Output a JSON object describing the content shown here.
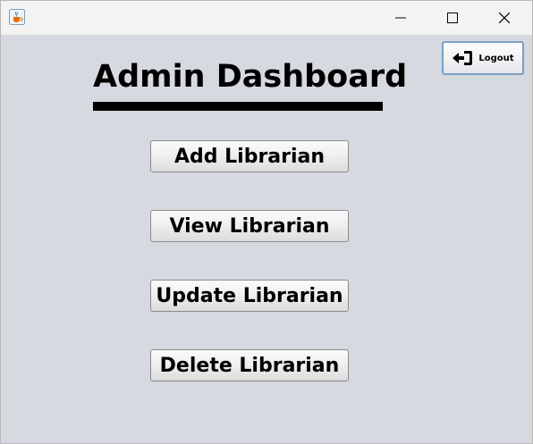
{
  "window": {
    "app_icon": "java-cup-icon",
    "controls": {
      "minimize_icon": "minimize-icon",
      "maximize_icon": "maximize-icon",
      "close_icon": "close-icon"
    }
  },
  "dashboard": {
    "title": "Admin Dashboard",
    "logout": {
      "label": "Logout",
      "icon": "logout-icon"
    },
    "buttons": [
      {
        "label": "Add Librarian"
      },
      {
        "label": "View Librarian"
      },
      {
        "label": "Update Librarian"
      },
      {
        "label": "Delete Librarian"
      }
    ]
  },
  "colors": {
    "background": "#d6d9e0",
    "titlebar": "#f3f3f3",
    "text": "#000000",
    "logout_border": "#7a9fc6"
  }
}
